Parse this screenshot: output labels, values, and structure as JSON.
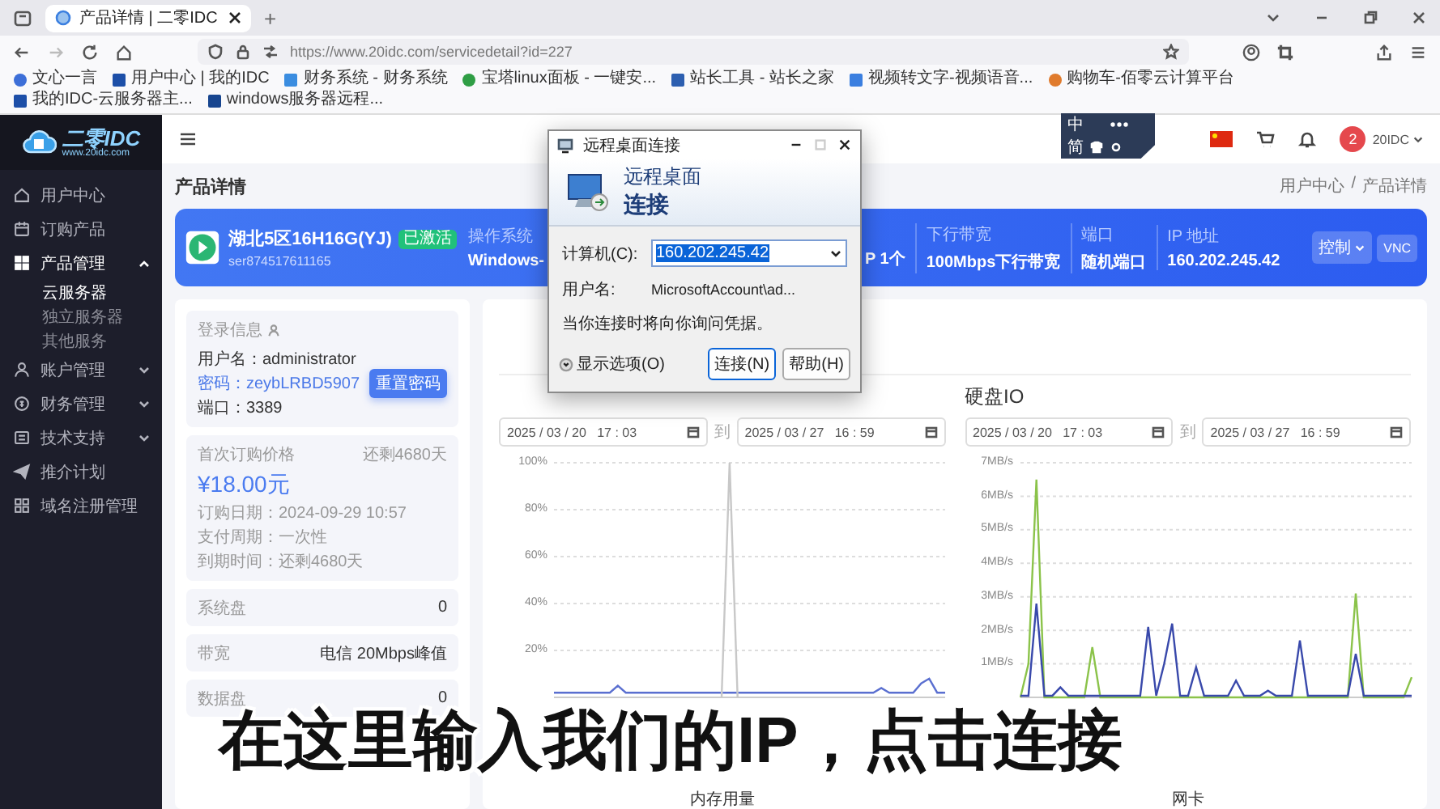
{
  "browser": {
    "tab": {
      "title": "产品详情 | 二零IDC",
      "selected": true
    },
    "new_tab": "+",
    "url": "https://www.20idc.com/servicedetail?id=227",
    "bookmarks": [
      "文心一言",
      "用户中心 | 我的IDC",
      "财务系统 - 财务系统",
      "宝塔linux面板 - 一键安...",
      "站长工具 - 站长之家",
      "视频转文字-视频语音...",
      "购物车-佰零云计算平台",
      "我的IDC-云服务器主...",
      "windows服务器远程..."
    ]
  },
  "ime": {
    "mode": "中",
    "script": "简"
  },
  "sidebar": {
    "logo": "二零IDC",
    "logo_url": "www.20idc.com",
    "items": [
      {
        "kind": "link",
        "label": "用户中心"
      },
      {
        "kind": "link",
        "label": "订购产品"
      },
      {
        "kind": "group",
        "label": "产品管理",
        "expanded": true,
        "children": [
          {
            "label": "云服务器",
            "selected": true
          },
          {
            "label": "独立服务器",
            "selected": false
          },
          {
            "label": "其他服务",
            "selected": false
          }
        ]
      },
      {
        "kind": "group",
        "label": "账户管理",
        "expanded": false
      },
      {
        "kind": "group",
        "label": "财务管理",
        "expanded": false
      },
      {
        "kind": "group",
        "label": "技术支持",
        "expanded": false
      },
      {
        "kind": "link",
        "label": "推介计划"
      },
      {
        "kind": "link",
        "label": "域名注册管理"
      }
    ]
  },
  "header": {
    "avatar": "2",
    "user": "20IDC"
  },
  "page": {
    "title": "产品详情",
    "breadcrumb": [
      "用户中心",
      "产品详情"
    ],
    "breadcrumb_separator": "/"
  },
  "banner": {
    "name": "湖北5区16H16G(YJ)",
    "badge": "已激活",
    "id": "ser874517611165",
    "specs": [
      {
        "label": "操作系统",
        "value": "Windows-"
      },
      {
        "value": "P 1个"
      },
      {
        "label": "下行带宽",
        "value": "100Mbps下行带宽"
      },
      {
        "label": "端口",
        "value": "随机端口"
      },
      {
        "label": "IP 地址",
        "value": "160.202.245.42"
      }
    ],
    "buttons": [
      {
        "label": "控制",
        "kind": "dropdown"
      },
      {
        "label": "VNC",
        "kind": "plain"
      }
    ]
  },
  "login": {
    "title": "登录信息",
    "fields": [
      {
        "label": "用户名：",
        "value": "administrator",
        "kind": "text"
      },
      {
        "label": "密码：",
        "value": "zeybLRBD5907",
        "kind": "link"
      },
      {
        "label": "端口：",
        "value": "3389",
        "kind": "text"
      }
    ],
    "button": "重置密码"
  },
  "order": {
    "title": "首次订购价格",
    "remaining": "还剩4680天",
    "price": "¥18.00元",
    "rows": [
      "订购日期：2024-09-29 10:57",
      "支付周期：一次性",
      "到期时间：还剩4680天"
    ]
  },
  "resources": [
    {
      "label": "系统盘",
      "value": "0"
    },
    {
      "label": "带宽",
      "value": "电信 20Mbps峰值"
    },
    {
      "label": "数据盘",
      "value": "0"
    }
  ],
  "monitors": [
    {
      "from": "2025 / 03 / 20   17 : 03",
      "separator": "到",
      "to": "2025 / 03 / 27   16 : 59",
      "caption": "内存用量",
      "chart_data": {
        "type": "line",
        "grid": true,
        "ylim": [
          0,
          100
        ],
        "yticks": [
          {
            "value": 100,
            "label": "100%"
          },
          {
            "value": 80,
            "label": "80%"
          },
          {
            "value": 60,
            "label": "60%"
          },
          {
            "value": 40,
            "label": "40%"
          },
          {
            "value": 20,
            "label": "20%"
          }
        ],
        "series": [
          {
            "color": "#5a6fd0",
            "values": [
              2,
              2,
              2,
              2,
              2,
              2,
              2,
              2,
              5,
              2,
              2,
              2,
              2,
              2,
              2,
              2,
              2,
              2,
              2,
              2,
              2,
              2,
              2,
              2,
              2,
              2,
              2,
              2,
              2,
              2,
              2,
              2,
              2,
              2,
              2,
              2,
              2,
              2,
              2,
              2,
              2,
              4,
              2,
              2,
              2,
              2,
              6,
              8,
              2,
              2
            ]
          },
          {
            "color": "#c8c8c8",
            "values": [
              null,
              null,
              null,
              null,
              null,
              null,
              null,
              null,
              null,
              null,
              null,
              null,
              null,
              null,
              null,
              null,
              null,
              null,
              null,
              null,
              null,
              0,
              100,
              0,
              null,
              null,
              null,
              null,
              null,
              null,
              null,
              null,
              null,
              null,
              null,
              null,
              null,
              null,
              null,
              null,
              null,
              null,
              null,
              null,
              null,
              null,
              null,
              null,
              null,
              null
            ]
          }
        ]
      }
    },
    {
      "title": "硬盘IO",
      "from": "2025 / 03 / 20   17 : 03",
      "separator": "到",
      "to": "2025 / 03 / 27   16 : 59",
      "caption": "网卡",
      "chart_data": {
        "type": "line",
        "grid": true,
        "ylim": [
          0,
          7
        ],
        "yticks": [
          {
            "value": 7,
            "label": "7MB/s"
          },
          {
            "value": 6,
            "label": "6MB/s"
          },
          {
            "value": 5,
            "label": "5MB/s"
          },
          {
            "value": 4,
            "label": "4MB/s"
          },
          {
            "value": 3,
            "label": "3MB/s"
          },
          {
            "value": 2,
            "label": "2MB/s"
          },
          {
            "value": 1,
            "label": "1MB/s"
          }
        ],
        "series": [
          {
            "color": "#8bc34a",
            "values": [
              0,
              1,
              6.5,
              0,
              0,
              0,
              0,
              0,
              0,
              1.5,
              0,
              0,
              0,
              0,
              0,
              0,
              0,
              0,
              0,
              0,
              0,
              0,
              0,
              0,
              0,
              0,
              0,
              0,
              0,
              0,
              0,
              0,
              0,
              0,
              0,
              0,
              0,
              0,
              0,
              0,
              0,
              0,
              3.1,
              0,
              0,
              0,
              0,
              0,
              0,
              0.6
            ]
          },
          {
            "color": "#3949ab",
            "values": [
              0.05,
              0.05,
              2.8,
              0.05,
              0.05,
              0.3,
              0.05,
              0.05,
              0.05,
              0.05,
              0.05,
              0.05,
              0.05,
              0.05,
              0.05,
              0.05,
              2.1,
              0.05,
              1,
              2.2,
              0.05,
              0.05,
              0.9,
              0.05,
              0.05,
              0.05,
              0.05,
              0.5,
              0.05,
              0.05,
              0.05,
              0.2,
              0.05,
              0.05,
              0.05,
              1.7,
              0.05,
              0.05,
              0.05,
              0.05,
              0.05,
              0.05,
              1.3,
              0.05,
              0.05,
              0.05,
              0.05,
              0.05,
              0.05,
              0.05
            ]
          }
        ]
      }
    }
  ],
  "dialog": {
    "title": "远程桌面连接",
    "heading_top": "远程桌面",
    "heading": "连接",
    "computer_label": "计算机(C):",
    "computer_value": "160.202.245.42",
    "value_selected": true,
    "user_label": "用户名:",
    "user_value": "MicrosoftAccount\\ad...",
    "note": "当你连接时将向你询问凭据。",
    "options": "显示选项(O)",
    "buttons": [
      {
        "label": "连接(N)",
        "default": true
      },
      {
        "label": "帮助(H)",
        "default": false
      }
    ]
  },
  "caption": "在这里输入我们的IP，点击连接"
}
